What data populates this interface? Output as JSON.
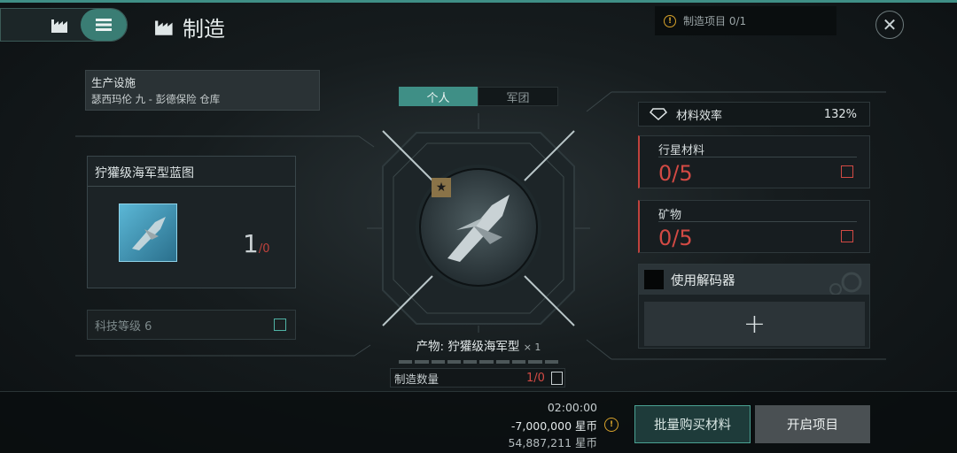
{
  "header": {
    "title": "制造",
    "notice": "制造项目 0/1"
  },
  "facility": {
    "label": "生产设施",
    "location": "瑟西玛伦 九 - 彭德保险 仓库"
  },
  "blueprint": {
    "name": "狞獾级海军型蓝图",
    "count": "1",
    "max": "/0"
  },
  "tech": {
    "label": "科技等级 6"
  },
  "tabs": [
    "个人",
    "军团"
  ],
  "product": {
    "label": "产物:",
    "name": "狞獾级海军型",
    "multiplier": "× 1"
  },
  "quantity": {
    "label": "制造数量",
    "value": "1/0"
  },
  "efficiency": {
    "label": "材料效率",
    "value": "132%"
  },
  "materials": [
    {
      "name": "行星材料",
      "value": "0/5"
    },
    {
      "name": "矿物",
      "value": "0/5"
    }
  ],
  "decoder": {
    "label": "使用解码器",
    "add": "+"
  },
  "footer": {
    "time": "02:00:00",
    "cost": "-7,000,000 星币",
    "balance": "54,887,211 星币",
    "buy_button": "批量购买材料",
    "start_button": "开启项目"
  },
  "colors": {
    "accent": "#3f8f86",
    "warning": "#d24a44",
    "alert": "#d9a32b"
  }
}
